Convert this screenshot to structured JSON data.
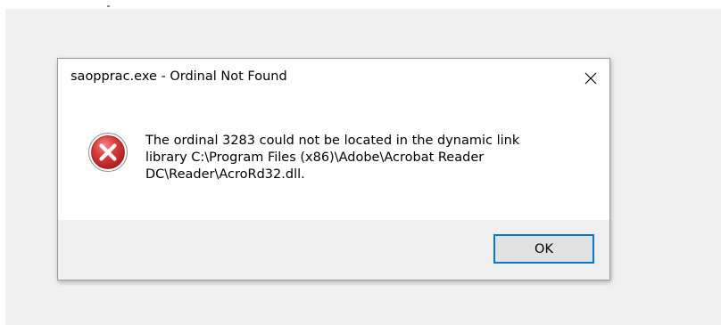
{
  "dialog": {
    "title": "saopprac.exe - Ordinal Not Found",
    "close_icon": "close-icon",
    "error_icon": "error-icon",
    "message_lines": [
      "The ordinal 3283 could not be located in the dynamic link",
      "library C:\\Program Files (x86)\\Adobe\\Acrobat Reader",
      "DC\\Reader\\AcroRd32.dll."
    ],
    "ok_label": "OK"
  },
  "colors": {
    "accent": "#0078d7",
    "error_red": "#d43c3c",
    "dialog_background": "#f0f0f0",
    "content_background": "#ffffff"
  }
}
